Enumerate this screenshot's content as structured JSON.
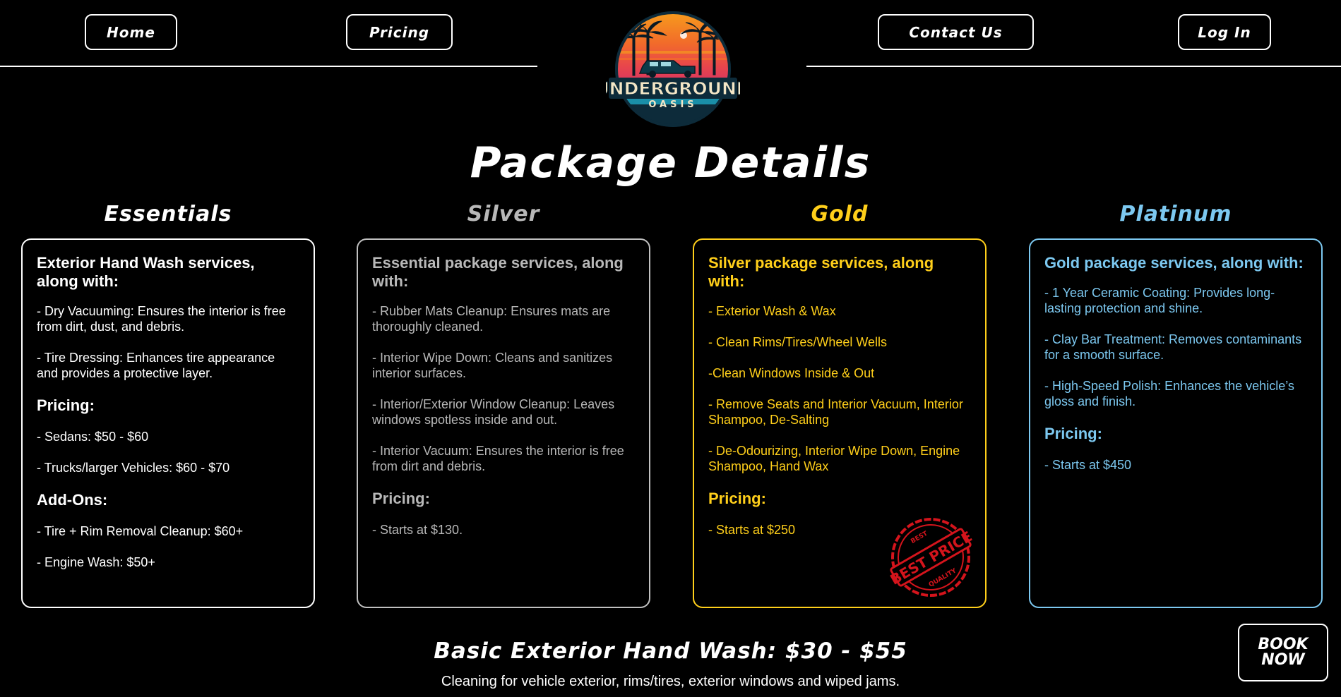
{
  "nav": {
    "home": "Home",
    "pricing": "Pricing",
    "contact": "Contact Us",
    "login": "Log In"
  },
  "logo": {
    "line1": "UNDERGROUND",
    "line2": "OASIS"
  },
  "page_title": "Package Details",
  "packages": [
    {
      "name": "Essentials",
      "color": "#ffffff",
      "heading": "Exterior Hand Wash services, along with:",
      "items": [
        "- Dry Vacuuming: Ensures the interior is free from dirt, dust, and debris.",
        "- Tire Dressing: Enhances tire appearance and provides a protective layer."
      ],
      "pricing_label": "Pricing:",
      "pricing": [
        "- Sedans: $50 - $60",
        "- Trucks/larger Vehicles: $60 - $70"
      ],
      "addons_label": "Add-Ons:",
      "addons": [
        "- Tire + Rim Removal Cleanup: $60+",
        "- Engine Wash: $50+"
      ]
    },
    {
      "name": "Silver",
      "color": "#b8b8b8",
      "heading": "Essential package services, along with:",
      "items": [
        "- Rubber Mats Cleanup: Ensures mats are thoroughly cleaned.",
        "- Interior Wipe Down: Cleans and sanitizes interior surfaces.",
        "- Interior/Exterior Window Cleanup: Leaves windows spotless inside and out.",
        "- Interior Vacuum: Ensures the interior is free from dirt and debris."
      ],
      "pricing_label": "Pricing:",
      "pricing": [
        "- Starts at $130."
      ]
    },
    {
      "name": "Gold",
      "color": "#ffcf1a",
      "heading": "Silver package services, along with:",
      "items": [
        "- Exterior Wash & Wax",
        "- Clean Rims/Tires/Wheel Wells",
        "-Clean Windows Inside & Out",
        "- Remove Seats and Interior Vacuum, Interior Shampoo, De-Salting",
        "- De-Odourizing, Interior Wipe Down, Engine Shampoo, Hand Wax"
      ],
      "pricing_label": "Pricing:",
      "pricing": [
        "- Starts at $250"
      ],
      "stamp": {
        "main": "BEST PRICE",
        "top": "BEST",
        "bottom": "QUALITY"
      }
    },
    {
      "name": "Platinum",
      "color": "#7cc8f0",
      "heading": "Gold package services, along with:",
      "items": [
        "- 1 Year Ceramic Coating: Provides long-lasting protection and shine.",
        "- Clay Bar Treatment: Removes contaminants for a smooth surface.",
        "- High-Speed Polish: Enhances the vehicle’s gloss and finish."
      ],
      "pricing_label": "Pricing:",
      "pricing": [
        "- Starts at $450"
      ]
    }
  ],
  "basic": {
    "title": "Basic Exterior Hand Wash: $30 - $55",
    "description": "Cleaning for vehicle exterior, rims/tires, exterior windows and wiped jams."
  },
  "book_now": {
    "line1": "BOOK",
    "line2": "NOW"
  }
}
